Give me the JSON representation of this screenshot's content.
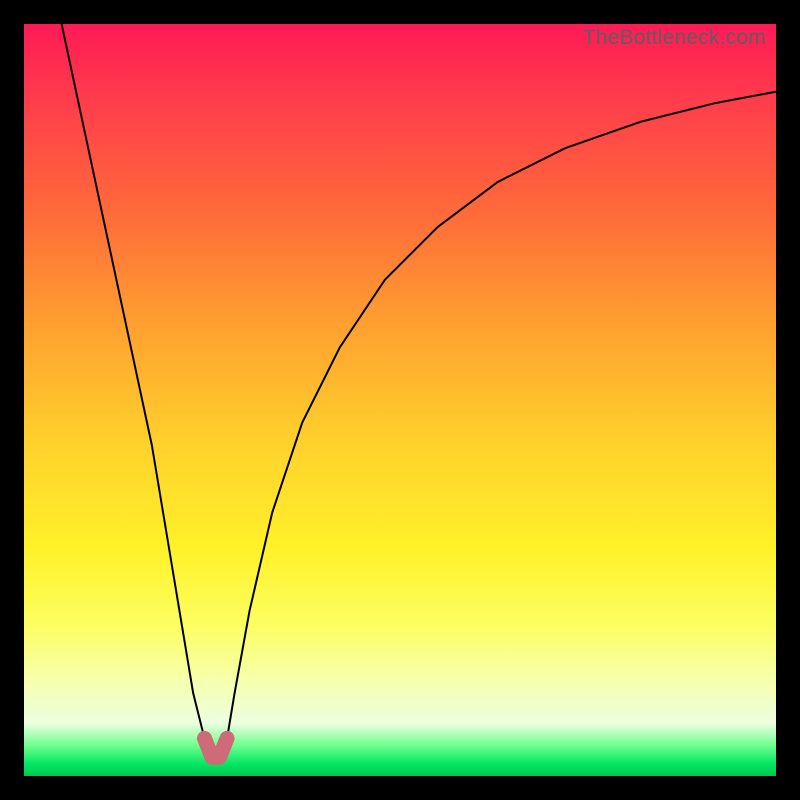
{
  "watermark": "TheBottleneck.com",
  "chart_data": {
    "type": "line",
    "title": "",
    "xlabel": "",
    "ylabel": "",
    "xlim": [
      0,
      100
    ],
    "ylim": [
      0,
      100
    ],
    "series": [
      {
        "name": "bottleneck-curve",
        "x": [
          5,
          8,
          11,
          14,
          17,
          19,
          21,
          22.5,
          24,
          25,
          26,
          27,
          28,
          30,
          33,
          37,
          42,
          48,
          55,
          63,
          72,
          82,
          92,
          100
        ],
        "y": [
          100,
          86,
          72,
          58,
          44,
          32,
          20,
          11,
          5,
          2.5,
          2.5,
          5,
          11,
          22,
          35,
          47,
          57,
          66,
          73,
          79,
          83.5,
          87,
          89.5,
          91
        ]
      }
    ],
    "highlight": {
      "name": "minimum-zone",
      "x": [
        24,
        25,
        26,
        27
      ],
      "y": [
        5,
        2.5,
        2.5,
        5
      ],
      "color": "#cf6a78"
    },
    "gradient_meaning": "vertical gradient from red (top, high bottleneck) through yellow to green (bottom, no bottleneck)"
  }
}
